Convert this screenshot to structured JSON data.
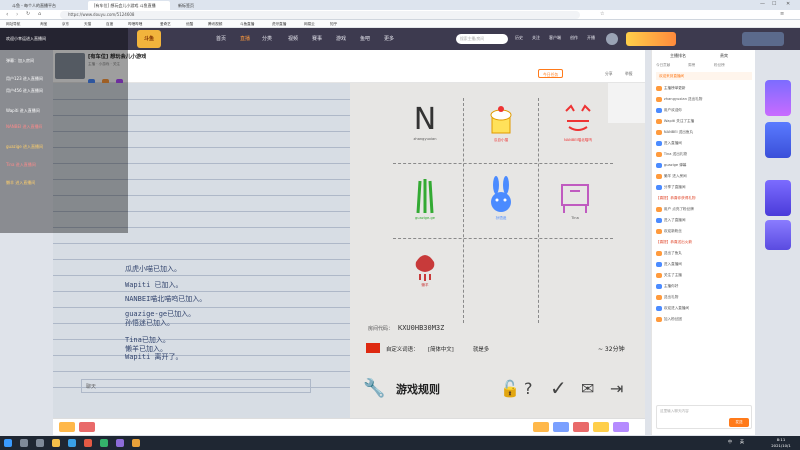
{
  "browser": {
    "tabs": [
      "斗鱼 - 每个人的直播平台",
      "[有车位] 想玩会儿小游戏 斗鱼直播",
      "新标签页"
    ],
    "url": "https://www.douyu.com/5124608",
    "bookmarks": [
      "网址导航",
      "淘宝",
      "京东",
      "天猫",
      "百度",
      "哔哩哔哩",
      "爱奇艺",
      "优酷",
      "腾讯视频",
      "斗鱼直播",
      "虎牙直播",
      "网易云",
      "知乎"
    ]
  },
  "site_nav": {
    "logo": "斗鱼",
    "items": [
      "首页",
      "直播",
      "分类",
      "视频",
      "赛事",
      "游戏",
      "鱼吧",
      "更多"
    ],
    "search_placeholder": "搜索主播/房间",
    "right_items": [
      "历史",
      "关注",
      "客户端",
      "创作",
      "开播"
    ]
  },
  "chat_overlay": [
    "欢迎小幸运进入直播间",
    "弹幕：加入房间",
    "用户123 进入直播间",
    "用户456 进入直播间",
    "Wapiti 进入直播间",
    "NANBEI 进入直播间",
    "guazige 进入直播间",
    "Tina 进入直播间",
    "懒羊 进入直播间"
  ],
  "stream": {
    "title": "[有车位] 想玩会儿小游戏",
    "meta": "主播 · 小游戏 · 关注",
    "follow_label": "今日任务",
    "share_label": "分享",
    "report_label": "举报"
  },
  "game": {
    "players": [
      {
        "name": "zhangyuxian"
      },
      {
        "name": "瓜自小猫"
      },
      {
        "name": "NANBEI喵北喵呜"
      },
      {
        "name": "guazige-ge"
      },
      {
        "name": "孙悟迷"
      },
      {
        "name": "Tina"
      },
      {
        "name": "懒羊"
      }
    ],
    "room_code_label": "房间代码：",
    "room_code": "KXU0HB30M3Z",
    "custom_words_label": "自定义词语：",
    "language": "[简体中文]",
    "language_suffix": "就是多",
    "time": "~ 32分钟",
    "rules_label": "游戏规则",
    "log_lines": [
      "瓜虎小喵已加入。",
      "Wapiti 已加入。",
      "NANBEI喵北喵呜已加入。",
      "guazige-ge已加入。",
      "孙悟迷已加入。",
      "Tina已加入。",
      "懒羊已加入。",
      "Wapiti 离开了。"
    ],
    "chat_hint": "聊天"
  },
  "right_panel": {
    "tabs": [
      "主播排名",
      "贵宾"
    ],
    "subtabs": [
      "今日贡献",
      "周榜",
      "粉丝榜"
    ],
    "notice": "欢迎来到直播间",
    "messages": [
      "主播榜单更新",
      "zhangyuxian 送出礼物",
      "用户欢迎你",
      "Wapiti 关注了主播",
      "NANBEI 送出鱼丸",
      "进入直播间",
      "Tina 送出礼物",
      "guazige 弹幕",
      "懒羊 进入房间",
      "分享了直播间",
      "【喜提】恭喜你获得礼物",
      "用户 点亮了粉丝牌",
      "进入了直播间",
      "欢迎新粉丝",
      "【喜提】恭喜送出火箭",
      "送出了鱼丸",
      "进入直播间",
      "关注了主播",
      "主播你好",
      "送出礼物",
      "欢迎进入直播间",
      "加入粉丝团"
    ],
    "input_placeholder": "这里输入聊天内容",
    "send_label": "发送"
  },
  "taskbar": {
    "time": "8:11",
    "date": "2021/10/1",
    "tray": [
      "中",
      "英"
    ]
  },
  "colors": {
    "nav_bg": "#3d3a4f",
    "accent_orange": "#ff7a1a",
    "pill_blue": "#4b8bff",
    "pill_orange": "#ff9a3c"
  }
}
